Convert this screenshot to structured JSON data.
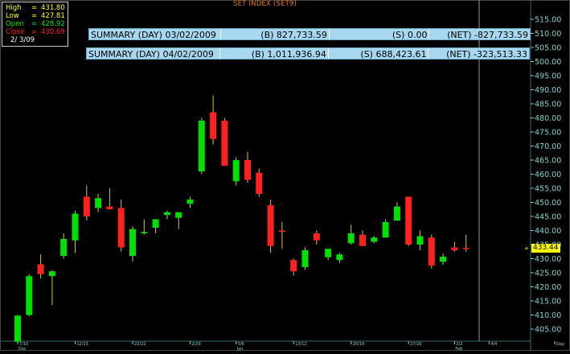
{
  "ohlc_box": {
    "high": {
      "label": "High",
      "value": "431.80",
      "color": "#ffff00"
    },
    "low": {
      "label": "Low",
      "value": "427.81",
      "color": "#ffff00"
    },
    "open": {
      "label": "Open",
      "value": "428.92",
      "color": "#00e000"
    },
    "close": {
      "label": "Close",
      "value": "430.69",
      "color": "#ff2020"
    },
    "date": "2/ 3/09"
  },
  "title": "SET INDEX  (SET9)",
  "summaries": [
    {
      "label": "SUMMARY (DAY) 03/02/2009",
      "buy": "(B) 827,733.59",
      "sell": "(S) 0.00",
      "net": "(NET) -827,733.59"
    },
    {
      "label": "SUMMARY (DAY) 04/02/2009",
      "buy": "(B) 1,011,936.94",
      "sell": "(S) 688,423.61",
      "net": "(NET) -323,513.33"
    }
  ],
  "current_price": "433.44",
  "colors": {
    "background": "#000000",
    "up": "#00e000",
    "down": "#ff2020",
    "axis_text": "#7fd3d3",
    "grid": "#3a6a6a",
    "cursor_line": "#999999",
    "summary_bg": "#a8d8f0",
    "price_label": "#ffff00",
    "title": "#e07a1f"
  },
  "chart_data": {
    "type": "candlestick",
    "title": "SET INDEX  (SET9)",
    "ylim": [
      400,
      520
    ],
    "yticks": [
      "405.00",
      "410.00",
      "415.00",
      "420.00",
      "425.00",
      "430.00",
      "435.00",
      "440.00",
      "445.00",
      "450.00",
      "455.00",
      "460.00",
      "465.00",
      "470.00",
      "475.00",
      "480.00",
      "485.00",
      "490.00",
      "495.00",
      "500.00",
      "505.00",
      "510.00",
      "515.00"
    ],
    "xticks": [
      {
        "top": "7/10",
        "bottom": "Dec",
        "index": 0
      },
      {
        "top": "12/15",
        "bottom": "",
        "index": 5
      },
      {
        "top": "22/22",
        "bottom": "",
        "index": 10
      },
      {
        "top": "2/29",
        "bottom": "",
        "index": 15
      },
      {
        "top": "5/6",
        "bottom": "Jan",
        "index": 19
      },
      {
        "top": "13/12",
        "bottom": "",
        "index": 24
      },
      {
        "top": "20/19",
        "bottom": "",
        "index": 29
      },
      {
        "top": "27/26",
        "bottom": "",
        "index": 34
      },
      {
        "top": "2/2",
        "bottom": "Feb",
        "index": 38
      },
      {
        "top": "4/4",
        "bottom": "",
        "index": 41
      },
      {
        "top": "Day",
        "bottom": "",
        "index": 48
      }
    ],
    "candles": [
      {
        "o": 400.5,
        "h": 410.0,
        "l": 400.5,
        "c": 409.8
      },
      {
        "o": 410.0,
        "h": 424.5,
        "l": 409.5,
        "c": 423.8
      },
      {
        "o": 428.0,
        "h": 431.5,
        "l": 423.0,
        "c": 424.5
      },
      {
        "o": 423.8,
        "h": 426.0,
        "l": 413.5,
        "c": 425.5
      },
      {
        "o": 431.0,
        "h": 439.0,
        "l": 430.0,
        "c": 437.0
      },
      {
        "o": 436.5,
        "h": 447.0,
        "l": 432.0,
        "c": 446.0
      },
      {
        "o": 452.0,
        "h": 456.0,
        "l": 443.5,
        "c": 445.0
      },
      {
        "o": 448.0,
        "h": 453.0,
        "l": 446.5,
        "c": 451.5
      },
      {
        "o": 448.5,
        "h": 455.0,
        "l": 447.5,
        "c": 447.5
      },
      {
        "o": 448.0,
        "h": 451.0,
        "l": 432.5,
        "c": 434.0
      },
      {
        "o": 431.0,
        "h": 441.5,
        "l": 429.0,
        "c": 440.5
      },
      {
        "o": 439.0,
        "h": 444.0,
        "l": 438.5,
        "c": 439.5
      },
      {
        "o": 441.0,
        "h": 444.0,
        "l": 439.0,
        "c": 444.0
      },
      {
        "o": 445.5,
        "h": 447.0,
        "l": 444.0,
        "c": 446.5
      },
      {
        "o": 444.5,
        "h": 446.0,
        "l": 440.5,
        "c": 446.5
      },
      {
        "o": 449.5,
        "h": 452.0,
        "l": 448.0,
        "c": 451.0
      },
      {
        "o": 461.0,
        "h": 480.0,
        "l": 460.0,
        "c": 479.0
      },
      {
        "o": 482.0,
        "h": 488.0,
        "l": 470.5,
        "c": 472.5
      },
      {
        "o": 479.0,
        "h": 480.0,
        "l": 463.0,
        "c": 463.0
      },
      {
        "o": 457.5,
        "h": 466.0,
        "l": 456.0,
        "c": 465.0
      },
      {
        "o": 465.0,
        "h": 468.0,
        "l": 457.0,
        "c": 458.0
      },
      {
        "o": 460.5,
        "h": 462.0,
        "l": 452.0,
        "c": 453.0
      },
      {
        "o": 449.0,
        "h": 451.0,
        "l": 432.0,
        "c": 434.5
      },
      {
        "o": 440.0,
        "h": 443.0,
        "l": 433.5,
        "c": 439.5
      },
      {
        "o": 429.5,
        "h": 430.0,
        "l": 424.0,
        "c": 425.5
      },
      {
        "o": 427.0,
        "h": 434.0,
        "l": 426.0,
        "c": 433.0
      },
      {
        "o": 439.0,
        "h": 440.0,
        "l": 435.0,
        "c": 436.5
      },
      {
        "o": 430.5,
        "h": 433.0,
        "l": 429.5,
        "c": 433.5
      },
      {
        "o": 429.5,
        "h": 432.0,
        "l": 428.5,
        "c": 431.5
      },
      {
        "o": 435.5,
        "h": 442.0,
        "l": 435.0,
        "c": 439.0
      },
      {
        "o": 438.5,
        "h": 440.0,
        "l": 434.5,
        "c": 434.5
      },
      {
        "o": 436.0,
        "h": 438.0,
        "l": 435.5,
        "c": 437.5
      },
      {
        "o": 437.5,
        "h": 444.0,
        "l": 437.5,
        "c": 443.0
      },
      {
        "o": 443.5,
        "h": 450.0,
        "l": 443.5,
        "c": 448.5
      },
      {
        "o": 452.0,
        "h": 452.0,
        "l": 434.5,
        "c": 435.0
      },
      {
        "o": 435.0,
        "h": 440.0,
        "l": 433.0,
        "c": 438.0
      },
      {
        "o": 437.5,
        "h": 438.5,
        "l": 426.5,
        "c": 427.5
      },
      {
        "o": 428.9,
        "h": 431.8,
        "l": 427.8,
        "c": 430.7
      },
      {
        "o": 434.0,
        "h": 436.0,
        "l": 432.5,
        "c": 433.0
      },
      {
        "o": 433.8,
        "h": 438.5,
        "l": 432.5,
        "c": 433.4
      }
    ]
  }
}
